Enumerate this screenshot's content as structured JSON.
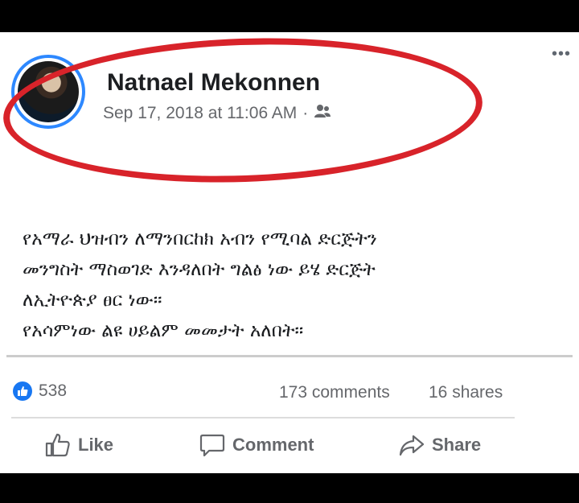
{
  "post": {
    "author": "Natnael Mekonnen",
    "timestamp": "Sep 17, 2018 at 11:06 AM",
    "separator": "·",
    "privacy_icon": "friends-icon",
    "more_label": "•••",
    "body": "የአማራ ህዝብን ለማንበርከክ አብን የሚባል ድርጅትን\nመንግስት ማስወገድ እንዳለበት ግልፅ ነው ይሄ ድርጅት\nለኢትዮጵያ ፀር ነው።\nየአሳምነው ልዩ ሀይልም መመታት አለበት።"
  },
  "stats": {
    "likes": "538",
    "comments": "173 comments",
    "shares": "16 shares"
  },
  "actions": {
    "like": "Like",
    "comment": "Comment",
    "share": "Share"
  },
  "colors": {
    "accent": "#1877f2",
    "annotation": "#d8232a",
    "muted_text": "#65676b"
  }
}
